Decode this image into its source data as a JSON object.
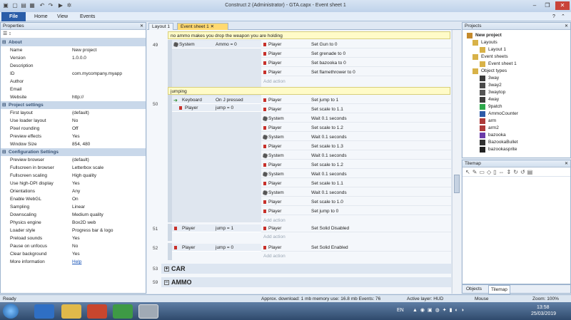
{
  "window": {
    "title": "Construct 2 (Administrator) - GTA.capx - Event sheet 1"
  },
  "ribbon": {
    "file": "File",
    "tabs": [
      "Home",
      "View",
      "Events"
    ]
  },
  "properties": {
    "header": "Properties",
    "rows": [
      {
        "k": "About",
        "cat": true
      },
      {
        "k": "Name",
        "v": "New project"
      },
      {
        "k": "Version",
        "v": "1.0.0.0"
      },
      {
        "k": "Description",
        "v": ""
      },
      {
        "k": "ID",
        "v": "com.mycompany.myapp"
      },
      {
        "k": "Author",
        "v": ""
      },
      {
        "k": "Email",
        "v": ""
      },
      {
        "k": "Website",
        "v": "http://"
      },
      {
        "k": "Project settings",
        "cat": true
      },
      {
        "k": "First layout",
        "v": "(default)"
      },
      {
        "k": "Use loader layout",
        "v": "No"
      },
      {
        "k": "Pixel rounding",
        "v": "Off"
      },
      {
        "k": "Preview effects",
        "v": "Yes"
      },
      {
        "k": "Window Size",
        "v": "854, 480"
      },
      {
        "k": "Configuration Settings",
        "cat": true
      },
      {
        "k": "Preview browser",
        "v": "(default)"
      },
      {
        "k": "Fullscreen in browser",
        "v": "Letterbox scale"
      },
      {
        "k": "Fullscreen scaling",
        "v": "High quality"
      },
      {
        "k": "Use high-DPI display",
        "v": "Yes"
      },
      {
        "k": "Orientations",
        "v": "Any"
      },
      {
        "k": "Enable WebGL",
        "v": "On"
      },
      {
        "k": "Sampling",
        "v": "Linear"
      },
      {
        "k": "Downscaling",
        "v": "Medium quality"
      },
      {
        "k": "Physics engine",
        "v": "Box2D web"
      },
      {
        "k": "Loader style",
        "v": "Progress bar & logo"
      },
      {
        "k": "Preload sounds",
        "v": "Yes"
      },
      {
        "k": "Pause on unfocus",
        "v": "No"
      },
      {
        "k": "Clear background",
        "v": "Yes"
      },
      {
        "k": "More information",
        "v": "Help"
      }
    ]
  },
  "tabs": [
    "Layout 1",
    "Event sheet 1"
  ],
  "events": {
    "comment1": "no ammo makes you drop the weapon you are holding",
    "ev49": {
      "num": "49",
      "cond_obj": "System",
      "cond_txt": "Ammo = 0",
      "actions": [
        {
          "obj": "Player",
          "txt": "Set Gun to 0"
        },
        {
          "obj": "Player",
          "txt": "Set grenade to 0"
        },
        {
          "obj": "Player",
          "txt": "Set bazooka to 0"
        },
        {
          "obj": "Player",
          "txt": "Set flamethrower to 0"
        }
      ]
    },
    "comment2": "jumping",
    "ev50": {
      "num": "50",
      "conds": [
        {
          "obj": "Keyboard",
          "txt": "On J pressed"
        },
        {
          "obj": "Player",
          "txt": "jump = 0"
        }
      ],
      "actions": [
        {
          "obj": "Player",
          "txt": "Set jump to 1"
        },
        {
          "obj": "Player",
          "txt": "Set scale to 1.1"
        },
        {
          "obj": "System",
          "txt": "Wait 0.1 seconds"
        },
        {
          "obj": "Player",
          "txt": "Set scale to 1.2"
        },
        {
          "obj": "System",
          "txt": "Wait 0.1 seconds"
        },
        {
          "obj": "Player",
          "txt": "Set scale to 1.3"
        },
        {
          "obj": "System",
          "txt": "Wait 0.1 seconds"
        },
        {
          "obj": "Player",
          "txt": "Set scale to 1.2"
        },
        {
          "obj": "System",
          "txt": "Wait 0.1 seconds"
        },
        {
          "obj": "Player",
          "txt": "Set scale to 1.1"
        },
        {
          "obj": "System",
          "txt": "Wait 0.1 seconds"
        },
        {
          "obj": "Player",
          "txt": "Set scale to 1.0"
        },
        {
          "obj": "Player",
          "txt": "Set jump to 0"
        }
      ]
    },
    "ev51": {
      "num": "51",
      "cond_obj": "Player",
      "cond_txt": "jump = 1",
      "act_obj": "Player",
      "act_txt": "Set  Solid Disabled"
    },
    "ev52": {
      "num": "52",
      "cond_obj": "Player",
      "cond_txt": "jump = 0",
      "act_obj": "Player",
      "act_txt": "Set  Solid Enabled"
    },
    "add_action": "Add action",
    "group53": {
      "num": "53",
      "label": "CAR"
    },
    "group59": {
      "num": "59",
      "label": "AMMO"
    }
  },
  "projects": {
    "header": "Projects",
    "items": [
      "New project",
      "Layouts",
      "Layout 1",
      "Event sheets",
      "Event sheet 1",
      "Object types",
      "3way",
      "3way2",
      "3waytop",
      "4way",
      "9patch",
      "AmmoCounter",
      "arm",
      "arm2",
      "bazooka",
      "BazookaBullet",
      "bazookasprite"
    ],
    "tabs": [
      "Objects",
      "Tilemap"
    ]
  },
  "tilemap": {
    "header": "Tilemap"
  },
  "status": {
    "ready": "Ready",
    "download": "Approx. download: 1 mb  memory use: 16.8 mb  Events: 76",
    "layer": "Active layer: HUD",
    "mouse": "Mouse",
    "zoom": "Zoom: 100%"
  },
  "taskbar": {
    "lang": "EN",
    "time": "13:58",
    "date": "25/03/2019"
  }
}
